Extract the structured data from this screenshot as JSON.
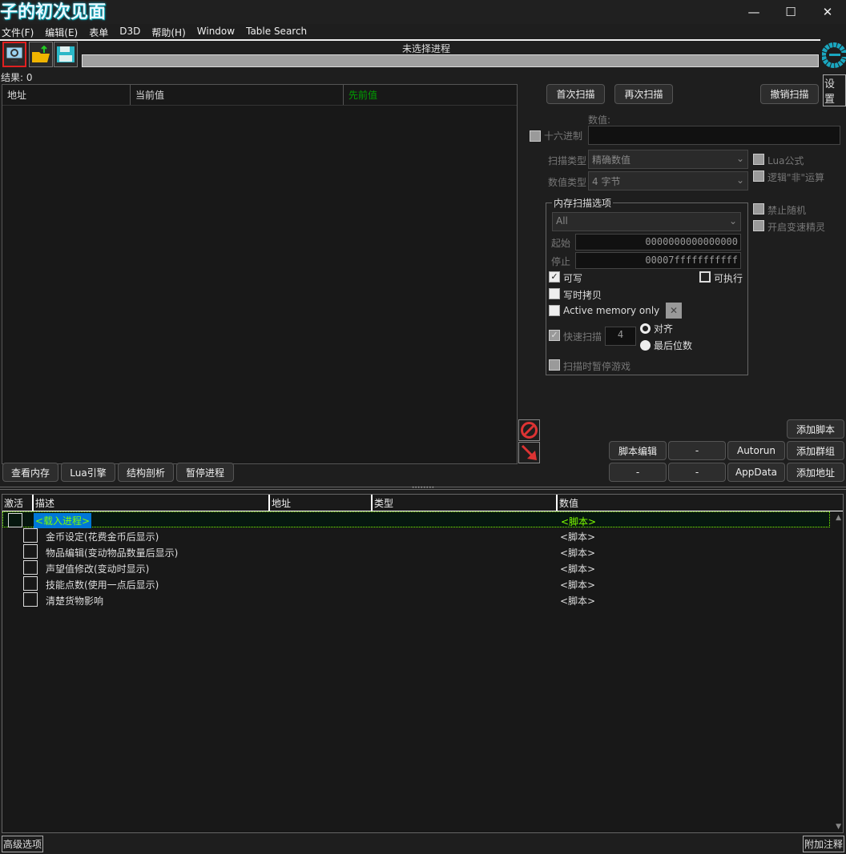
{
  "window": {
    "title": "子的初次见面",
    "minimize": "—",
    "maximize": "☐",
    "close": "✕"
  },
  "menu": [
    "文件(F)",
    "编辑(E)",
    "表单",
    "D3D",
    "帮助(H)",
    "Window",
    "Table Search"
  ],
  "process": {
    "label": "未选择进程",
    "progress": 0
  },
  "results": "结果: 0",
  "settings": "设置",
  "found_list": {
    "columns": [
      "地址",
      "当前值",
      "先前值"
    ]
  },
  "scan": {
    "first": "首次扫描",
    "next": "再次扫描",
    "undo": "撤销扫描",
    "value_label": "数值:",
    "hex": "十六进制",
    "value": "",
    "scan_type_label": "扫描类型",
    "scan_type": "精确数值",
    "value_type_label": "数值类型",
    "value_type": "4 字节",
    "lua": "Lua公式",
    "not": "逻辑\"非\"运算",
    "no_random": "禁止随机",
    "speedhack": "开启变速精灵"
  },
  "memory": {
    "title": "内存扫描选项",
    "region": "All",
    "start_label": "起始",
    "start": "0000000000000000",
    "stop_label": "停止",
    "stop": "00007fffffffffff",
    "writable": "可写",
    "executable": "可执行",
    "cow": "写时拷贝",
    "active": "Active memory only",
    "fast": "快速扫描",
    "fast_value": "4",
    "align": "对齐",
    "last_digits": "最后位数",
    "pause": "扫描时暂停游戏"
  },
  "bottom_buttons": [
    "查看内存",
    "Lua引擎",
    "结构剖析",
    "暂停进程"
  ],
  "right_buttons": {
    "add_script": "添加脚本",
    "script_edit": "脚本编辑",
    "dash1": "-",
    "autorun": "Autorun",
    "add_group": "添加群组",
    "dash2": "-",
    "dash3": "-",
    "appdata": "AppData",
    "add_address": "添加地址"
  },
  "table": {
    "columns": [
      "激活",
      "描述",
      "地址",
      "类型",
      "数值"
    ],
    "rows": [
      {
        "desc": "<载入进程>",
        "value": "<脚本>"
      },
      {
        "desc": "金币设定(花费金币后显示)",
        "value": "<脚本>"
      },
      {
        "desc": "物品编辑(变动物品数量后显示)",
        "value": "<脚本>"
      },
      {
        "desc": "声望值修改(变动时显示)",
        "value": "<脚本>"
      },
      {
        "desc": "技能点数(使用一点后显示)",
        "value": "<脚本>"
      },
      {
        "desc": "清楚货物影响",
        "value": "<脚本>"
      }
    ]
  },
  "footer": {
    "advanced": "高级选项",
    "comments": "附加注释"
  },
  "colors": {
    "accent": "#19b7d6",
    "previous": "#00a000",
    "selected": "#0078d7",
    "green_text": "#7fff00"
  }
}
